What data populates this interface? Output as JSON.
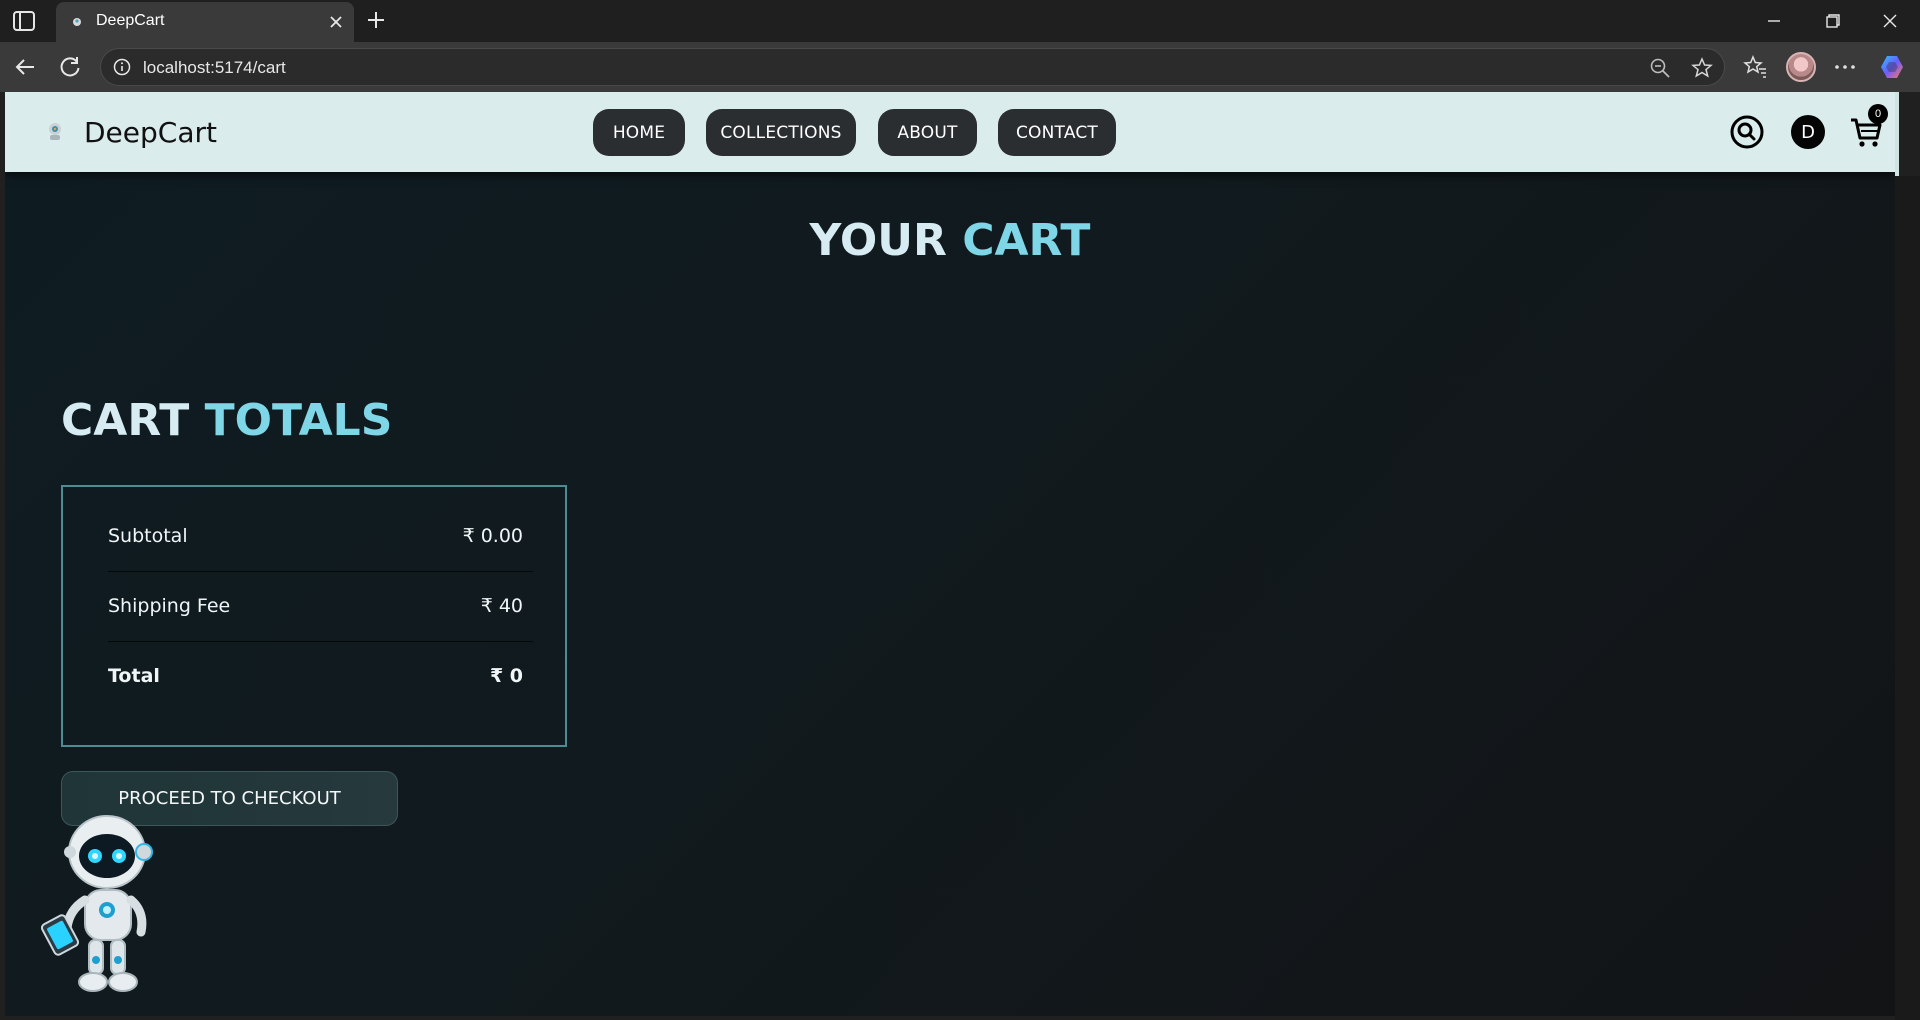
{
  "browser": {
    "tab_title": "DeepCart",
    "url": "localhost:5174/cart",
    "icons": [
      "sidebar-icon",
      "favicon",
      "close-icon",
      "plus-icon",
      "minimize-icon",
      "restore-icon",
      "window-close-icon",
      "back-icon",
      "reload-icon",
      "info-icon",
      "zoom-out-icon",
      "star-icon",
      "favorites-icon",
      "profile-avatar",
      "more-icon",
      "copilot-icon"
    ]
  },
  "site": {
    "brand": "DeepCart",
    "nav": [
      "HOME",
      "COLLECTIONS",
      "ABOUT",
      "CONTACT"
    ],
    "user_initial": "D",
    "cart_count": "0"
  },
  "cart": {
    "title_part1": "YOUR",
    "title_part2": "CART",
    "totals_part1": "CART",
    "totals_part2": "TOTALS",
    "subtotal_label": "Subtotal",
    "subtotal_value": "₹ 0.00",
    "shipping_label": "Shipping Fee",
    "shipping_value": "₹ 40",
    "total_label": "Total",
    "total_value": "₹ 0",
    "checkout_label": "PROCEED TO CHECKOUT"
  },
  "colors": {
    "header_bg": "#dbecec",
    "accent": "#7fd6e6",
    "box_border": "#4e8c93",
    "page_bg": "#0e1c22"
  }
}
